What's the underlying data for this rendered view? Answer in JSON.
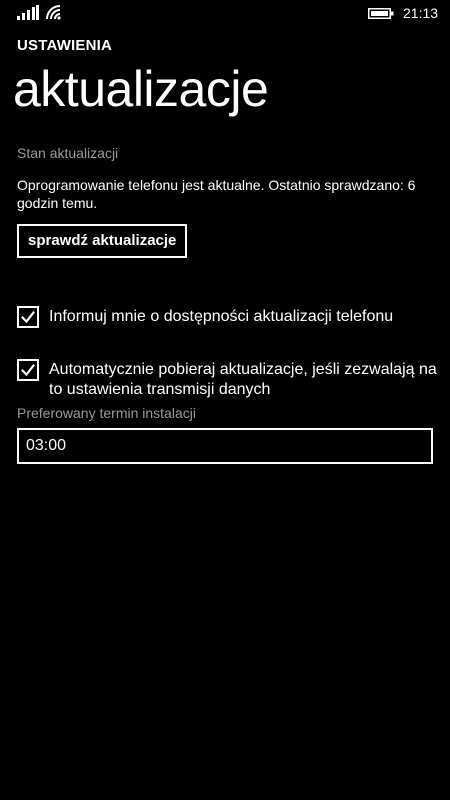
{
  "status_bar": {
    "time": "21:13",
    "signal_icon": "signal-bars-icon",
    "wifi_icon": "wifi-icon",
    "battery_icon": "battery-icon"
  },
  "header": {
    "app_title": "USTAWIENIA",
    "page_title": "aktualizacje"
  },
  "update_status": {
    "label": "Stan aktualizacji",
    "text": "Oprogramowanie telefonu jest aktualne. Ostatnio sprawdzano: 6 godzin temu.",
    "check_button_label": "sprawdź aktualizacje"
  },
  "options": [
    {
      "label": "Informuj mnie o dostępności aktualizacji telefonu",
      "checked": true
    },
    {
      "label": "Automatycznie pobieraj aktualizacje, jeśli zezwalają na to ustawienia transmisji danych",
      "checked": true
    }
  ],
  "install_time": {
    "label": "Preferowany termin instalacji",
    "value": "03:00"
  },
  "colors": {
    "background": "#000000",
    "foreground": "#ffffff",
    "secondary_text": "#9a9a9a"
  }
}
